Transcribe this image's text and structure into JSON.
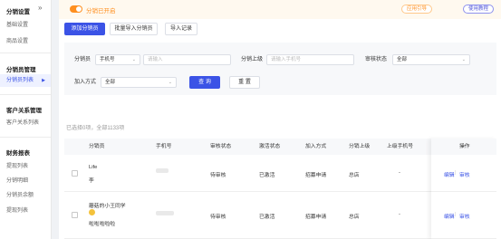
{
  "sidebar": {
    "collapse_icon": "double-chevron-icon",
    "groups": [
      {
        "title": "分销设置",
        "items": [
          "基础设置",
          "商品设置"
        ]
      },
      {
        "title": "分销员管理",
        "items": [
          "分销员列表"
        ]
      },
      {
        "title": "客户关系管理",
        "items": [
          "客户关系列表"
        ]
      },
      {
        "title": "财务报表",
        "items": [
          "提现列表",
          "分销明细",
          "分销员余额",
          "提现列表"
        ]
      }
    ],
    "active_item": "分销员列表"
  },
  "topbar": {
    "status_text": "分销已开启",
    "guide_label": "应用引导",
    "tutorial_label": "使用教程",
    "colors": {
      "accent": "#ff8f1f",
      "primary": "#3b53e6"
    }
  },
  "actions": {
    "add": "添加分销员",
    "batch_import": "批量导入分销员",
    "import_log": "导入记录"
  },
  "filters": {
    "distributor_label": "分销员",
    "distributor_type": "手机号",
    "distributor_placeholder": "请输入",
    "superior_label": "分销上级",
    "superior_placeholder": "请输入手机号",
    "review_label": "审核状态",
    "review_value": "全部",
    "join_label": "加入方式",
    "join_value": "全部",
    "query": "查 询",
    "reset": "重 置"
  },
  "summary": "已选择0项，全部1133项",
  "table": {
    "columns": [
      "分销员",
      "手机号",
      "审核状态",
      "激活状态",
      "加入方式",
      "分销上级",
      "上级手机号",
      "操作"
    ],
    "rows": [
      {
        "name": "Life",
        "sub": "李",
        "review": "待审核",
        "active": "已激活",
        "join": "招募申请",
        "superior": "总店",
        "superior_phone": "-",
        "edit": "编辑",
        "review_action": "审核"
      },
      {
        "name": "蘑菇的小王同学",
        "sub": "啦啦啦啦啦",
        "review": "待审核",
        "active": "已激活",
        "join": "招募申请",
        "superior": "总店",
        "superior_phone": "-",
        "edit": "编辑",
        "review_action": "审核"
      }
    ]
  }
}
